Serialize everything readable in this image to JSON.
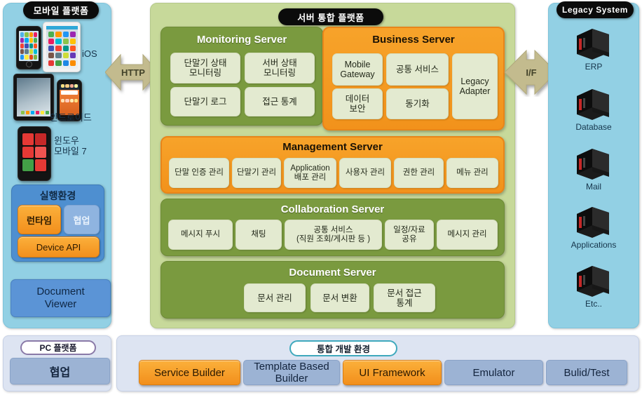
{
  "mobile_platform": {
    "title": "모바일 플랫폼",
    "devices": [
      {
        "name": "ios-device-group",
        "label": "iOS"
      },
      {
        "name": "android-device-group",
        "label": "안드로이드"
      },
      {
        "name": "windows-mobile-device",
        "label": "윈도우\n모바일 7"
      }
    ],
    "exec_env": {
      "title": "실행환경",
      "runtime": "런타임",
      "collaboration": "협업",
      "device_api": "Device API"
    },
    "document_viewer": "Document\nViewer"
  },
  "pc_platform": {
    "title": "PC 플랫폼",
    "collaboration": "협업"
  },
  "arrows": {
    "http": "HTTP",
    "interface": "I/F"
  },
  "server_platform": {
    "title": "서버 통합 플랫폼",
    "monitoring_server": {
      "title": "Monitoring Server",
      "cells": [
        "단말기 상태\n모니터링",
        "서버 상태\n모니터링",
        "단말기 로그",
        "접근 통계"
      ]
    },
    "business_server": {
      "title": "Business Server",
      "cells": [
        "Mobile\nGateway",
        "공통 서비스",
        "데이터\n보안",
        "동기화"
      ],
      "legacy_adapter": "Legacy\nAdapter"
    },
    "management_server": {
      "title": "Management Server",
      "cells": [
        "단말 인증 관리",
        "단말기 관리",
        "Application\n배포 관리",
        "사용자 관리",
        "권한 관리",
        "메뉴 관리"
      ]
    },
    "collaboration_server": {
      "title": "Collaboration Server",
      "cells": [
        "메시지 푸시",
        "채팅",
        "공통 서비스\n(직원 조회/게시판 등 )",
        "일정/자료\n공유",
        "메시지 관리"
      ]
    },
    "document_server": {
      "title": "Document Server",
      "cells": [
        "문서 관리",
        "문서 변환",
        "문서 접근\n통계"
      ]
    }
  },
  "legacy_system": {
    "title": "Legacy  System",
    "items": [
      "ERP",
      "Database",
      "Mail",
      "Applications",
      "Etc.."
    ]
  },
  "dev_env": {
    "title": "통합 개발 환경",
    "buttons": [
      {
        "label": "Service Builder",
        "style": "orange"
      },
      {
        "label": "Template Based\nBuilder",
        "style": "blue"
      },
      {
        "label": "UI Framework",
        "style": "orange"
      },
      {
        "label": "Emulator",
        "style": "blue"
      },
      {
        "label": "Bulid/Test",
        "style": "blue"
      }
    ]
  },
  "colors": {
    "panel_blue": "#92d0e4",
    "platform_green": "#c7d99a",
    "server_green": "#7a9a3f",
    "server_orange": "#f2921b",
    "cell_cream": "#e3ead0",
    "dev_panel": "#dde4f2",
    "arrow_khaki": "#c3bb8e"
  }
}
